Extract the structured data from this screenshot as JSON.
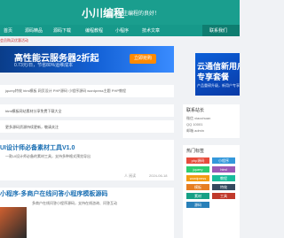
{
  "header": {
    "logo": "小川编程",
    "tagline": "关注编程的良好！"
  },
  "nav": {
    "items": [
      "首页",
      "源码精品",
      "源码下载",
      "编程教程",
      "小程序",
      "技术文章",
      "联系我们"
    ]
  },
  "notice": "会员购买优惠活动",
  "banner": {
    "title": "高性能云服务器2折起",
    "subtitle": "0.73元/日，节省80%运维成本",
    "button": "立即抢购"
  },
  "promo": {
    "line1": "云通信新用户",
    "line2": "专享套餐",
    "line3": "产品重磅升级，新用户专享"
  },
  "tags_row": "jquery特效 html模板 网页设计 PHP源码 小程序源码 wordpress主题 PHP教程",
  "card_a": "html模板网站素材分享免费下载大全",
  "card_b": "更多源码资源持续更新，敬请关注",
  "post1": {
    "title": "UI设计师必备素材工具V1.0",
    "desc": "一款UI设计师必备的素材工具，支持多种格式预览导出",
    "date": "2024-06-18",
    "views": "人 阅读"
  },
  "post2": {
    "title": "小程序-多商户在线问答小程序模板源码",
    "desc": "多商户在线问答小程序源码，支持在线咨询、问答互动"
  },
  "sidebar": {
    "title": "联系站长",
    "lines": [
      "微信 xiaochuan",
      "QQ 10001",
      "邮箱 admin"
    ],
    "tags_title": "热门标签",
    "tags": [
      "php源码",
      "小程序",
      "jquery",
      "html",
      "wordpress",
      "教程",
      "模板",
      "特效",
      "素材",
      "工具",
      "源码"
    ]
  },
  "colors": {
    "brand": "#1a9e8e",
    "nav": "#16998a",
    "title_blue": "#1a6fb3",
    "button": "#ff8a00"
  }
}
